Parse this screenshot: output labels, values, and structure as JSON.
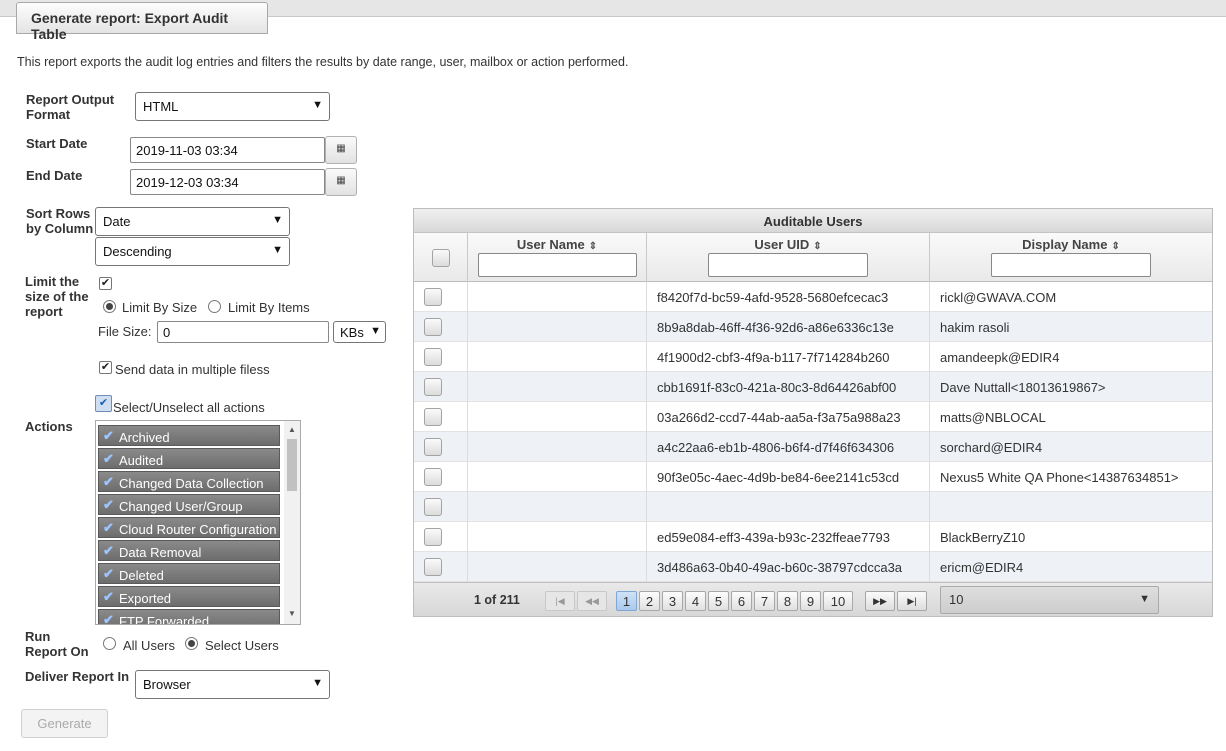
{
  "tab": {
    "title": "Generate report: Export Audit Table"
  },
  "description": "This report exports the audit log entries and filters the results by date range, user, mailbox or action performed.",
  "form": {
    "output_format_label": "Report Output Format",
    "output_format_value": "HTML",
    "start_date_label": "Start Date",
    "start_date_value": "2019-11-03 03:34",
    "end_date_label": "End Date",
    "end_date_value": "2019-12-03 03:34",
    "sort_label": "Sort Rows by Column",
    "sort_column_value": "Date",
    "sort_order_value": "Descending",
    "limit_label": "Limit the size of the report",
    "limit_by_size": "Limit By Size",
    "limit_by_items": "Limit By Items",
    "file_size_label": "File Size:",
    "file_size_value": "0",
    "file_size_unit": "KBs",
    "multiple_files_label": "Send data in multiple filess",
    "actions_label": "Actions",
    "select_all_label": "Select/Unselect all actions",
    "actions": [
      "Archived",
      "Audited",
      "Changed Data Collection",
      "Changed User/Group",
      "Cloud Router Configuration",
      "Data Removal",
      "Deleted",
      "Exported",
      "FTP Forwarded"
    ],
    "run_on_label": "Run Report On",
    "all_users": "All Users",
    "select_users": "Select Users",
    "deliver_label": "Deliver Report In",
    "deliver_value": "Browser",
    "generate": "Generate"
  },
  "grid": {
    "title": "Auditable Users",
    "columns": [
      "User Name",
      "User UID",
      "Display Name"
    ],
    "rows": [
      {
        "name": "",
        "uid": "f8420f7d-bc59-4afd-9528-5680efcecac3",
        "display": "rickl@GWAVA.COM"
      },
      {
        "name": "",
        "uid": "8b9a8dab-46ff-4f36-92d6-a86e6336c13e",
        "display": "hakim rasoli"
      },
      {
        "name": "",
        "uid": "4f1900d2-cbf3-4f9a-b117-7f714284b260",
        "display": "amandeepk@EDIR4"
      },
      {
        "name": "",
        "uid": "cbb1691f-83c0-421a-80c3-8d64426abf00",
        "display": "Dave Nuttall<18013619867>"
      },
      {
        "name": "",
        "uid": "03a266d2-ccd7-44ab-aa5a-f3a75a988a23",
        "display": "matts@NBLOCAL"
      },
      {
        "name": "",
        "uid": "a4c22aa6-eb1b-4806-b6f4-d7f46f634306",
        "display": "sorchard@EDIR4"
      },
      {
        "name": "",
        "uid": "90f3e05c-4aec-4d9b-be84-6ee2141c53cd",
        "display": "Nexus5 White QA Phone<14387634851>"
      },
      {
        "name": "",
        "uid": "",
        "display": ""
      },
      {
        "name": "",
        "uid": "ed59e084-eff3-439a-b93c-232ffeae7793",
        "display": "BlackBerryZ10"
      },
      {
        "name": "",
        "uid": "3d486a63-0b40-49ac-b60c-38797cdcca3a",
        "display": "ericm@EDIR4"
      }
    ],
    "pager": {
      "info": "1 of 211",
      "pages": [
        "1",
        "2",
        "3",
        "4",
        "5",
        "6",
        "7",
        "8",
        "9",
        "10"
      ],
      "current": "1",
      "page_size": "10"
    }
  }
}
